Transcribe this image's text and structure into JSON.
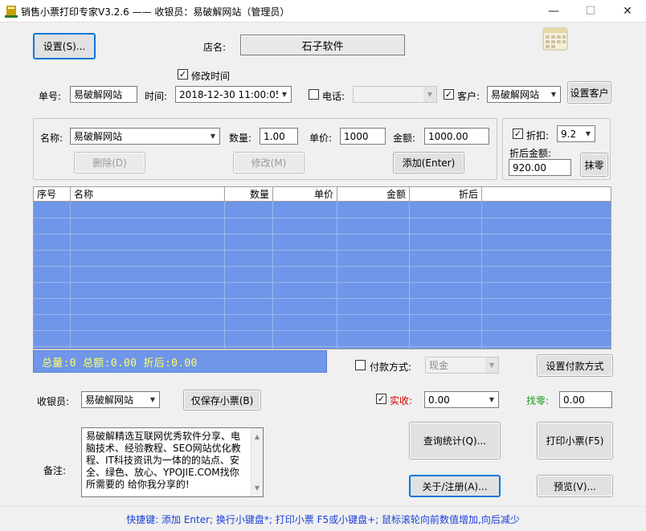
{
  "window": {
    "title": "销售小票打印专家V3.2.6 —— 收银员：易破解网站（管理员）",
    "minimize": "—",
    "maximize": "☐",
    "close": "✕"
  },
  "top": {
    "settings_btn": "设置(S)...",
    "shop_label": "店名:",
    "shop_name": "石子软件",
    "modify_time_label": "修改时间",
    "modify_time_checked": true,
    "order_no_label": "单号:",
    "order_no": "易破解网站",
    "time_label": "时间:",
    "time_value": "2018-12-30 11:00:05",
    "phone_label": "电话:",
    "phone_checked": false,
    "phone_value": "",
    "customer_label": "客户:",
    "customer_checked": true,
    "customer_value": "易破解网站",
    "set_customer_btn": "设置客户"
  },
  "item": {
    "name_label": "名称:",
    "name_value": "易破解网站",
    "qty_label": "数量:",
    "qty_value": "1.00",
    "price_label": "单价:",
    "price_value": "1000",
    "amount_label": "金额:",
    "amount_value": "1000.00",
    "delete_btn": "删除(D)",
    "modify_btn": "修改(M)",
    "add_btn": "添加(Enter)"
  },
  "discount": {
    "label": "折扣:",
    "checked": true,
    "value": "9.2",
    "after_label": "折后金额:",
    "after_value": "920.00",
    "round_btn": "抹零"
  },
  "table": {
    "columns": [
      "序号",
      "名称",
      "数量",
      "单价",
      "金额",
      "折后"
    ],
    "rows": []
  },
  "totals": {
    "text": "总量:0  总额:0.00  折后:0.00"
  },
  "payment": {
    "label": "付款方式:",
    "checked": false,
    "value": "现金",
    "set_btn": "设置付款方式"
  },
  "cashier": {
    "label": "收银员:",
    "value": "易破解网站",
    "save_only_btn": "仅保存小票(B)"
  },
  "received": {
    "label": "实收:",
    "checked": true,
    "value": "0.00",
    "change_label": "找零:",
    "change_value": "0.00"
  },
  "remark": {
    "label": "备注:",
    "text": "易破解精选互联网优秀软件分享、电脑技术、经验教程、SEO网站优化教程、IT科技资讯为一体的的站点、安全、绿色、放心、YPOJIE.COM找你所需要的 给你我分享的!"
  },
  "actions": {
    "query_btn": "查询统计(Q)...",
    "print_btn": "打印小票(F5)",
    "about_btn": "关于/注册(A)...",
    "preview_btn": "预览(V)..."
  },
  "status": {
    "text": "快捷键: 添加 Enter; 换行小键盘*; 打印小票 F5或小键盘+; 鼠标滚轮向前数值增加,向后减少"
  },
  "colors": {
    "grid_bg": "#6f96e8",
    "totals_text": "#ffff66",
    "status_text": "#1a3fd6",
    "received_label": "#d40000",
    "change_label": "#1a9a1a"
  }
}
